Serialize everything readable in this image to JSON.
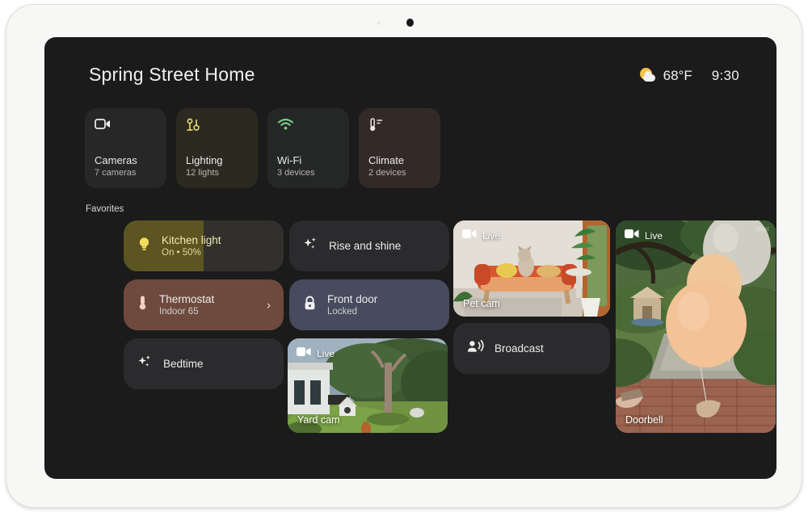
{
  "device": {
    "name": "tablet-frame"
  },
  "header": {
    "home_title": "Spring Street Home",
    "weather": {
      "icon": "partly-sunny-icon",
      "temperature": "68°F"
    },
    "time": "9:30"
  },
  "quick_actions": [
    {
      "icon": "video-camera-icon",
      "label": "Cameras",
      "sub": "7 cameras",
      "bg": "#272727",
      "icon_color": "#f0efed"
    },
    {
      "icon": "lighting-icon",
      "label": "Lighting",
      "sub": "12 lights",
      "bg": "#2c2a20",
      "icon_color": "#e8de72"
    },
    {
      "icon": "wifi-icon",
      "label": "Wi-Fi",
      "sub": "3 devices",
      "bg": "#242725",
      "icon_color": "#7ec98d"
    },
    {
      "icon": "thermometer-icon",
      "label": "Climate",
      "sub": "2 devices",
      "bg": "#332a28",
      "icon_color": "#f0e4e0"
    }
  ],
  "favorites": {
    "section_label": "Favorites",
    "kitchen_light": {
      "icon": "lightbulb-icon",
      "label": "Kitchen light",
      "sub": "On • 50%",
      "fill_percent": 50,
      "fill_color": "#5c5421",
      "track_color": "#31302c",
      "icon_color": "#f3dd5e",
      "text_color": "#f1e9ad"
    },
    "thermostat": {
      "icon": "thermometer-icon",
      "label": "Thermostat",
      "sub": "Indoor 65",
      "bg": "#6d4a3d",
      "icon_color": "#f4cfc4",
      "chevron": "chevron-right-icon"
    },
    "bedtime": {
      "icon": "sparkle-icon",
      "label": "Bedtime",
      "bg": "#2b2b2d",
      "icon_color": "#eeeeee"
    },
    "rise_and_shine": {
      "icon": "sparkle-icon",
      "label": "Rise and shine",
      "bg": "#2b2b2e",
      "icon_color": "#eeeeee"
    },
    "front_door": {
      "icon": "lock-closed-icon",
      "label": "Front door",
      "sub": "Locked",
      "bg": "#474b5e",
      "icon_color": "#f0f0f4"
    },
    "broadcast": {
      "icon": "broadcast-icon",
      "label": "Broadcast",
      "bg": "#2b2b2d",
      "icon_color": "#eeeeee"
    },
    "pet_cam": {
      "live_label": "Live",
      "name": "Pet cam",
      "icon": "video-camera-icon"
    },
    "yard_cam": {
      "live_label": "Live",
      "name": "Yard cam",
      "icon": "video-camera-icon"
    },
    "doorbell": {
      "live_label": "Live",
      "name": "Doorbell",
      "icon": "video-camera-icon",
      "watermark": "Nest"
    }
  }
}
